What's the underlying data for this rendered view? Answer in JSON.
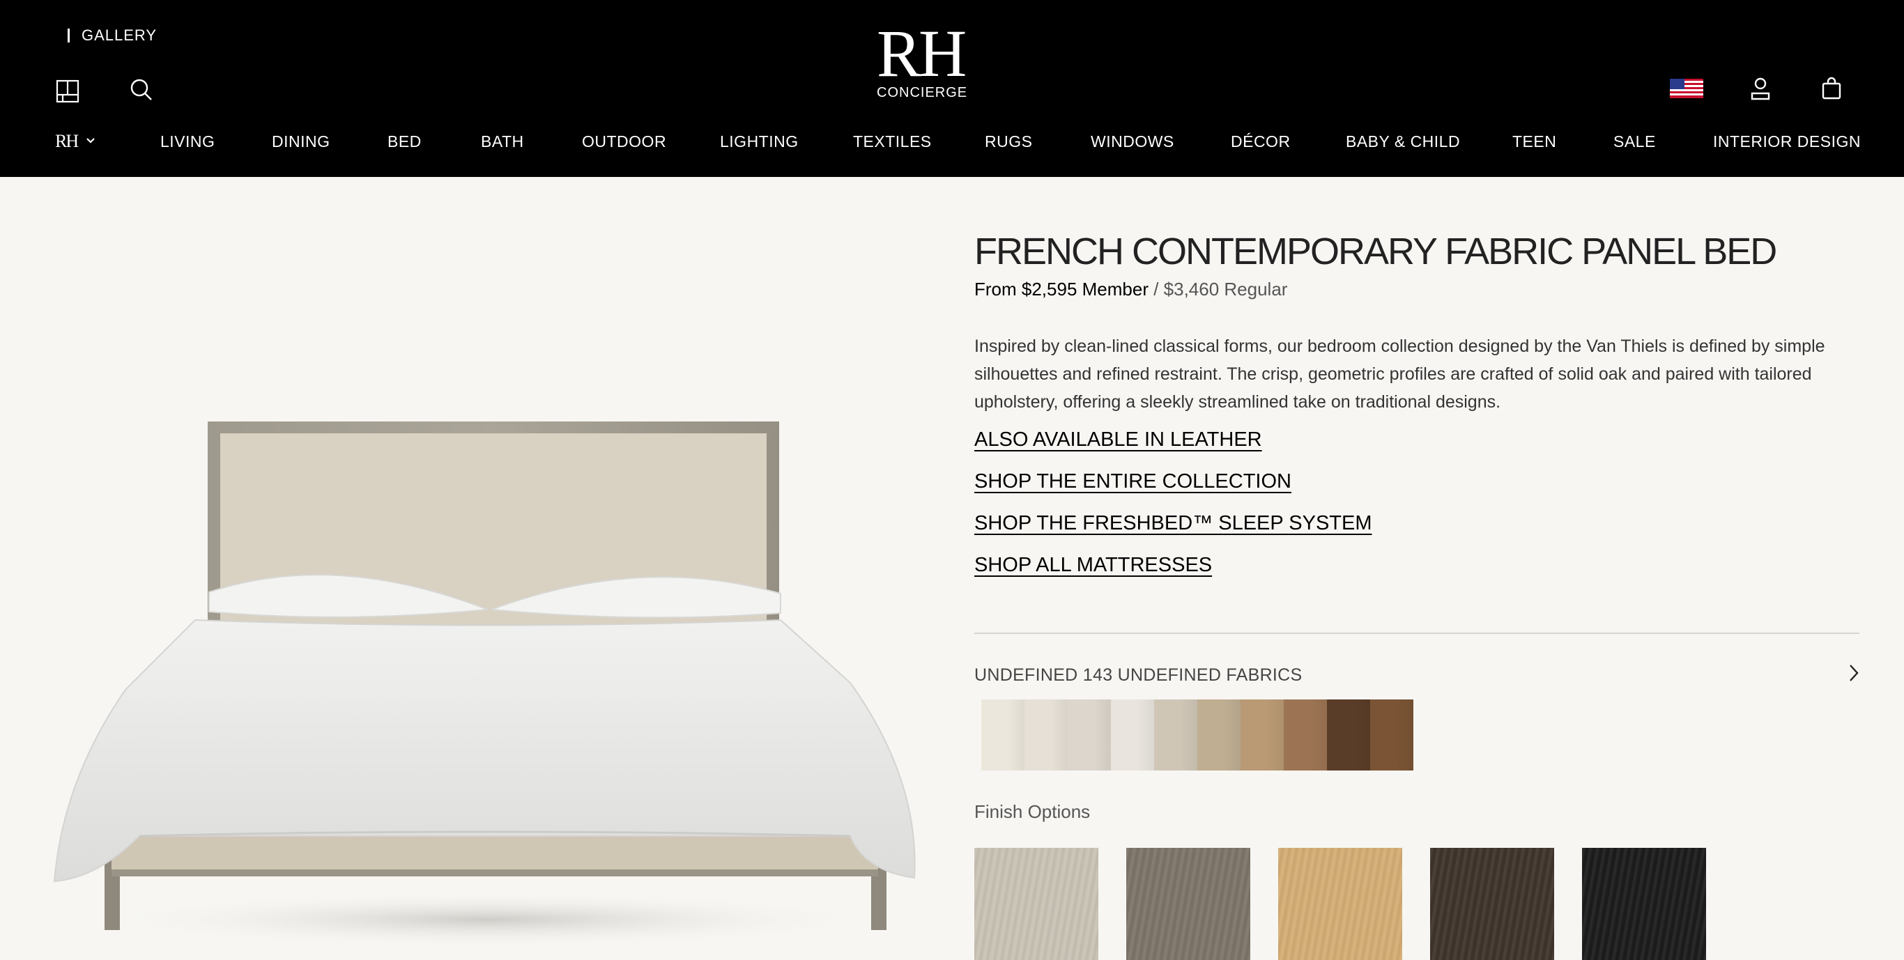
{
  "header": {
    "gallery_label": "GALLERY",
    "logo_main": "RH",
    "logo_sub": "CONCIERGE",
    "menu_mark": "RH"
  },
  "nav": {
    "items": [
      "LIVING",
      "DINING",
      "BED",
      "BATH",
      "OUTDOOR",
      "LIGHTING",
      "TEXTILES",
      "RUGS",
      "WINDOWS",
      "DÉCOR",
      "BABY & CHILD",
      "TEEN",
      "SALE",
      "INTERIOR DESIGN"
    ]
  },
  "icons": {
    "floorplan": "floorplan-icon",
    "search": "search-icon",
    "flag": "us-flag-icon",
    "account": "account-icon",
    "cart": "shopping-bag-icon"
  },
  "product": {
    "title": "FRENCH CONTEMPORARY FABRIC PANEL BED",
    "price_member": "From $2,595 Member",
    "price_separator": " / ",
    "price_regular": "$3,460 Regular",
    "description": "Inspired by clean-lined classical forms, our bedroom collection designed by the Van Thiels is defined by simple silhouettes and refined restraint. The crisp, geometric profiles are crafted of solid oak and paired with tailored upholstery, offering a sleekly streamlined take on traditional designs.",
    "links": [
      "ALSO AVAILABLE IN LEATHER",
      "SHOP THE ENTIRE COLLECTION",
      "SHOP THE FRESHBED™ SLEEP SYSTEM",
      "SHOP ALL MATTRESSES"
    ]
  },
  "fabrics": {
    "label": "UNDEFINED 143 UNDEFINED FABRICS",
    "swatch_colors": [
      "#ece7dc",
      "#e6e0d6",
      "#dcd6cc",
      "#e9e5de",
      "#cfc6b6",
      "#bfae92",
      "#b99a74",
      "#9c7453",
      "#5a3d28",
      "#7a5434"
    ]
  },
  "finishes": {
    "label": "Finish Options",
    "colors": [
      "#c9c2b5",
      "#7d7469",
      "#d4ad74",
      "#3f342c",
      "#1c1c1c"
    ]
  },
  "colors": {
    "header_bg": "#000000",
    "page_bg": "#f7f6f3"
  }
}
